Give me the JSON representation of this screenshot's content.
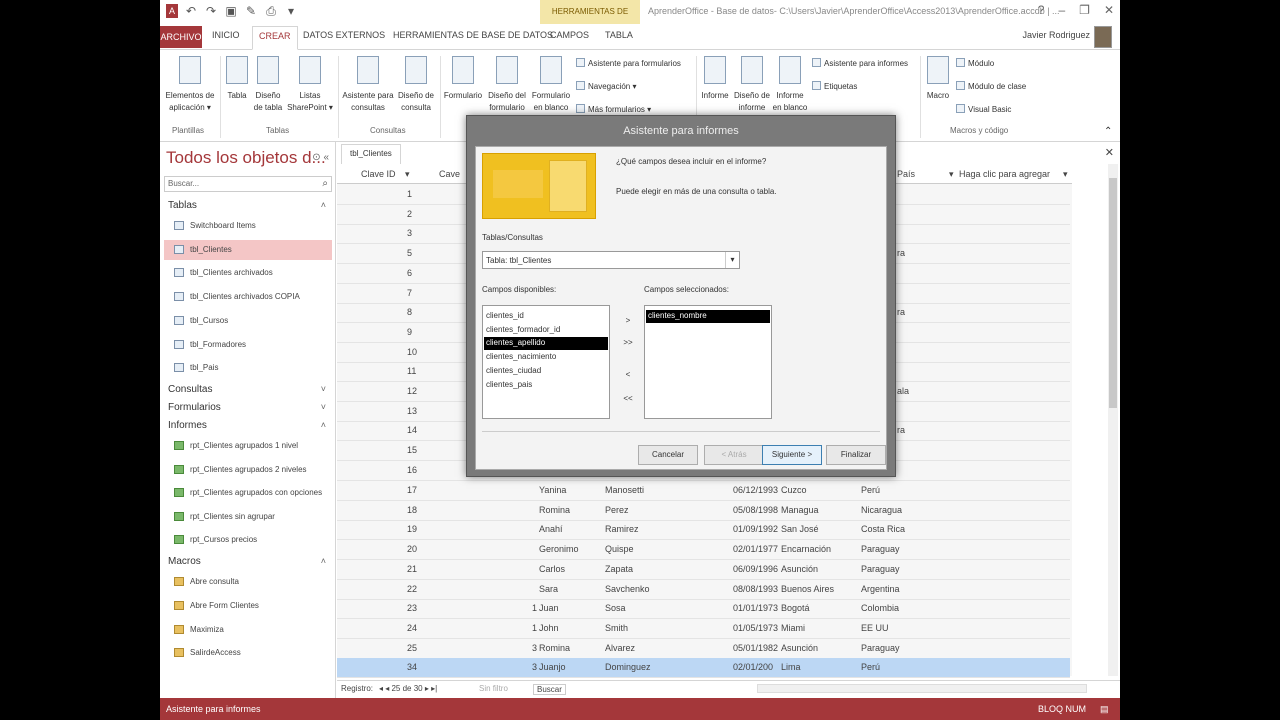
{
  "titlebar": {
    "context_tab": "HERRAMIENTAS DE TABLA",
    "window_title": "AprenderOffice - Base de datos- C:\\Users\\Javier\\AprenderOffice\\Access2013\\AprenderOffice.accdb | ...",
    "controls": [
      "?",
      "–",
      "❐",
      "✕"
    ],
    "user": "Javier Rodriguez"
  },
  "tabs": {
    "file": "ARCHIVO",
    "items": [
      "INICIO",
      "CREAR",
      "DATOS EXTERNOS",
      "HERRAMIENTAS DE BASE DE DATOS",
      "CAMPOS",
      "TABLA"
    ]
  },
  "ribbon": {
    "plantillas": {
      "btn1": "Elementos de",
      "btn1b": "aplicación ▾",
      "label": "Plantillas"
    },
    "tablas": {
      "tabla": "Tabla",
      "diseno": "Diseño",
      "diseno2": "de tabla",
      "listas": "Listas",
      "listas2": "SharePoint ▾",
      "label": "Tablas"
    },
    "consultas": {
      "asistente": "Asistente para",
      "asistente2": "consultas",
      "diseno": "Diseño de",
      "diseno2": "consulta",
      "label": "Consultas"
    },
    "formularios": {
      "formulario": "Formulario",
      "diseno": "Diseño del",
      "diseno2": "formulario",
      "blanco": "Formulario",
      "blanco2": "en blanco",
      "asistente": "Asistente para formularios",
      "navegacion": "Navegación ▾",
      "mas": "Más formularios ▾"
    },
    "informes": {
      "informe": "Informe",
      "diseno": "Diseño de",
      "diseno2": "informe",
      "blanco": "Informe",
      "blanco2": "en blanco",
      "asistente": "Asistente para informes",
      "etiquetas": "Etiquetas"
    },
    "macros": {
      "macro": "Macro",
      "modulo": "Módulo",
      "modulo_clase": "Módulo de clase",
      "vb": "Visual Basic",
      "label": "Macros y código"
    }
  },
  "nav": {
    "title": "Todos los objetos d...",
    "search_placeholder": "Buscar...",
    "sections": {
      "tablas": "Tablas",
      "consultas": "Consultas",
      "formularios": "Formularios",
      "informes": "Informes",
      "macros": "Macros"
    },
    "tables": [
      "Switchboard Items",
      "tbl_Clientes",
      "tbl_Clientes archivados",
      "tbl_Clientes archivados COPIA",
      "tbl_Cursos",
      "tbl_Formadores",
      "tbl_Pais"
    ],
    "reports": [
      "rpt_Clientes agrupados 1 nivel",
      "rpt_Clientes agrupados 2 niveles",
      "rpt_Clientes agrupados con opciones",
      "rpt_Clientes sin agrupar",
      "rpt_Cursos precios"
    ],
    "macros": [
      "Abre consulta",
      "Abre Form Clientes",
      "Maximiza",
      "SalirdeAccess"
    ]
  },
  "document": {
    "tab": "tbl_Clientes",
    "headers": {
      "clave": "Clave ID",
      "cave": "Cave",
      "pais": "País",
      "agregar": "Haga clic para agregar"
    },
    "top_ids": [
      "1",
      "2",
      "3",
      "5",
      "6",
      "7",
      "8",
      "9",
      "10",
      "11",
      "12",
      "13",
      "14",
      "15",
      "16"
    ],
    "top_pais_fragments": {
      "5": "ra",
      "8": "ra",
      "12": "ala",
      "14": "ra"
    },
    "rows": [
      {
        "id": "17",
        "n": "",
        "nombre": "Yanina",
        "apellido": "Manosetti",
        "fecha": "06/12/1993",
        "ciudad": "Cuzco",
        "pais": "Perú"
      },
      {
        "id": "18",
        "n": "",
        "nombre": "Romina",
        "apellido": "Perez",
        "fecha": "05/08/1998",
        "ciudad": "Managua",
        "pais": "Nicaragua"
      },
      {
        "id": "19",
        "n": "",
        "nombre": "Anahí",
        "apellido": "Ramirez",
        "fecha": "01/09/1992",
        "ciudad": "San José",
        "pais": "Costa Rica"
      },
      {
        "id": "20",
        "n": "",
        "nombre": "Geronimo",
        "apellido": "Quispe",
        "fecha": "02/01/1977",
        "ciudad": "Encarnación",
        "pais": "Paraguay"
      },
      {
        "id": "21",
        "n": "",
        "nombre": "Carlos",
        "apellido": "Zapata",
        "fecha": "06/09/1996",
        "ciudad": "Asunción",
        "pais": "Paraguay"
      },
      {
        "id": "22",
        "n": "",
        "nombre": "Sara",
        "apellido": "Savchenko",
        "fecha": "08/08/1993",
        "ciudad": "Buenos Aires",
        "pais": "Argentina"
      },
      {
        "id": "23",
        "n": "1",
        "nombre": "Juan",
        "apellido": "Sosa",
        "fecha": "01/01/1973",
        "ciudad": "Bogotá",
        "pais": "Colombia"
      },
      {
        "id": "24",
        "n": "1",
        "nombre": "John",
        "apellido": "Smith",
        "fecha": "01/05/1973",
        "ciudad": "Miami",
        "pais": "EE UU"
      },
      {
        "id": "25",
        "n": "3",
        "nombre": "Romina",
        "apellido": "Alvarez",
        "fecha": "05/01/1982",
        "ciudad": "Asunción",
        "pais": "Paraguay"
      },
      {
        "id": "34",
        "n": "3",
        "nombre": "Juanjo",
        "apellido": "Dominguez",
        "fecha": "02/01/200",
        "ciudad": "Lima",
        "pais": "Perú"
      }
    ],
    "recbar": {
      "label": "Registro:",
      "nav": "◂ ◂ 25 de 30 ▸ ▸|",
      "filter": "Sin filtro",
      "search": "Buscar"
    }
  },
  "dialog": {
    "title": "Asistente para informes",
    "question": "¿Qué campos desea incluir en el informe?",
    "hint": "Puede elegir en más de una consulta o tabla.",
    "tables_label": "Tablas/Consultas",
    "tables_value": "Tabla: tbl_Clientes",
    "available_label": "Campos disponibles:",
    "selected_label": "Campos seleccionados:",
    "available": [
      "clientes_id",
      "clientes_formador_id",
      "clientes_apellido",
      "clientes_nacimiento",
      "clientes_ciudad",
      "clientes_pais"
    ],
    "available_highlighted": "clientes_apellido",
    "selected": [
      "clientes_nombre"
    ],
    "move": {
      "one": ">",
      "all": ">>",
      "back": "<",
      "back_all": "<<"
    },
    "buttons": {
      "cancel": "Cancelar",
      "back": "< Atrás",
      "next": "Siguiente >",
      "finish": "Finalizar"
    }
  },
  "status": {
    "left": "Asistente para informes",
    "right": "BLOQ NUM"
  },
  "colors": {
    "accent": "#a4373a",
    "selection": "#bcd7f4",
    "nav_selected": "#f4c6c6"
  }
}
